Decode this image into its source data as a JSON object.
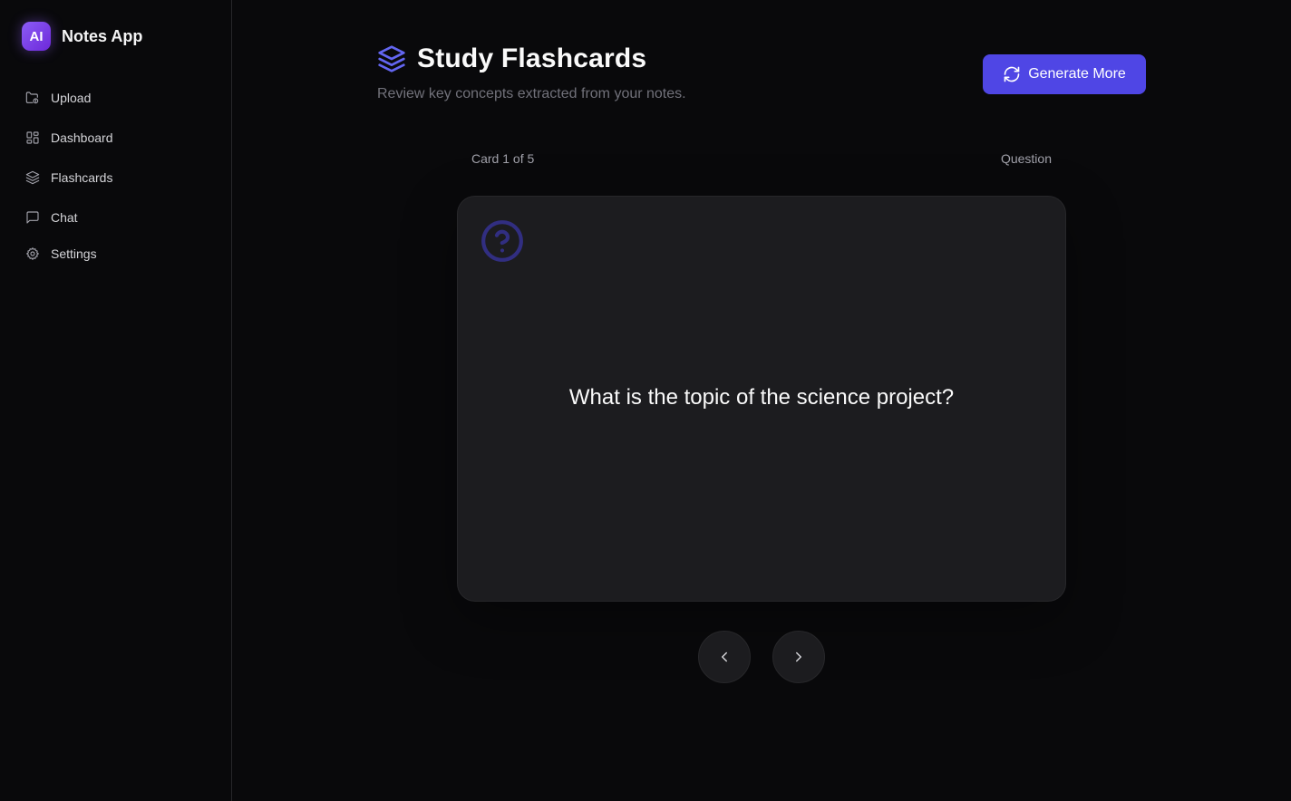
{
  "app": {
    "logo_text": "AI",
    "name": "Notes App"
  },
  "sidebar": {
    "items": [
      {
        "label": "Upload",
        "icon": "folder-upload-icon"
      },
      {
        "label": "Dashboard",
        "icon": "dashboard-grid-icon"
      },
      {
        "label": "Flashcards",
        "icon": "layers-icon"
      },
      {
        "label": "Chat",
        "icon": "chat-bubble-icon"
      },
      {
        "label": "Settings",
        "icon": "gear-icon"
      }
    ]
  },
  "header": {
    "title": "Study Flashcards",
    "subtitle": "Review key concepts extracted from your notes.",
    "generate_label": "Generate More"
  },
  "flashcard": {
    "counter": "Card 1 of 5",
    "side": "Question",
    "text": "What is the topic of the science project?"
  },
  "colors": {
    "accent": "#4f46e5",
    "brand_gradient_start": "#8b5cf6",
    "brand_gradient_end": "#6d28d9",
    "background": "#09090b",
    "card": "#1c1c1f"
  }
}
